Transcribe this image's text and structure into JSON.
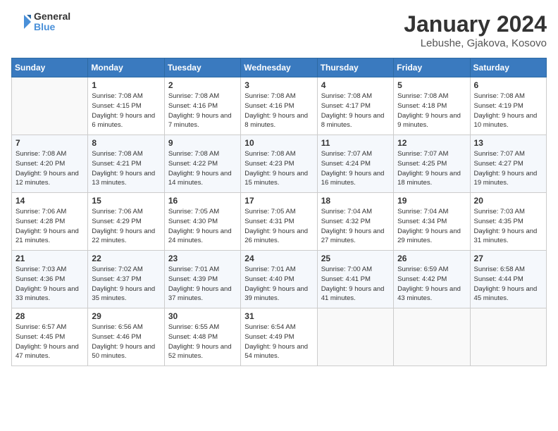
{
  "header": {
    "logo_text_general": "General",
    "logo_text_blue": "Blue",
    "month_title": "January 2024",
    "location": "Lebushe, Gjakova, Kosovo"
  },
  "days_of_week": [
    "Sunday",
    "Monday",
    "Tuesday",
    "Wednesday",
    "Thursday",
    "Friday",
    "Saturday"
  ],
  "weeks": [
    [
      {
        "num": "",
        "empty": true
      },
      {
        "num": "1",
        "sunrise": "Sunrise: 7:08 AM",
        "sunset": "Sunset: 4:15 PM",
        "daylight": "Daylight: 9 hours and 6 minutes."
      },
      {
        "num": "2",
        "sunrise": "Sunrise: 7:08 AM",
        "sunset": "Sunset: 4:16 PM",
        "daylight": "Daylight: 9 hours and 7 minutes."
      },
      {
        "num": "3",
        "sunrise": "Sunrise: 7:08 AM",
        "sunset": "Sunset: 4:16 PM",
        "daylight": "Daylight: 9 hours and 8 minutes."
      },
      {
        "num": "4",
        "sunrise": "Sunrise: 7:08 AM",
        "sunset": "Sunset: 4:17 PM",
        "daylight": "Daylight: 9 hours and 8 minutes."
      },
      {
        "num": "5",
        "sunrise": "Sunrise: 7:08 AM",
        "sunset": "Sunset: 4:18 PM",
        "daylight": "Daylight: 9 hours and 9 minutes."
      },
      {
        "num": "6",
        "sunrise": "Sunrise: 7:08 AM",
        "sunset": "Sunset: 4:19 PM",
        "daylight": "Daylight: 9 hours and 10 minutes."
      }
    ],
    [
      {
        "num": "7",
        "sunrise": "Sunrise: 7:08 AM",
        "sunset": "Sunset: 4:20 PM",
        "daylight": "Daylight: 9 hours and 12 minutes."
      },
      {
        "num": "8",
        "sunrise": "Sunrise: 7:08 AM",
        "sunset": "Sunset: 4:21 PM",
        "daylight": "Daylight: 9 hours and 13 minutes."
      },
      {
        "num": "9",
        "sunrise": "Sunrise: 7:08 AM",
        "sunset": "Sunset: 4:22 PM",
        "daylight": "Daylight: 9 hours and 14 minutes."
      },
      {
        "num": "10",
        "sunrise": "Sunrise: 7:08 AM",
        "sunset": "Sunset: 4:23 PM",
        "daylight": "Daylight: 9 hours and 15 minutes."
      },
      {
        "num": "11",
        "sunrise": "Sunrise: 7:07 AM",
        "sunset": "Sunset: 4:24 PM",
        "daylight": "Daylight: 9 hours and 16 minutes."
      },
      {
        "num": "12",
        "sunrise": "Sunrise: 7:07 AM",
        "sunset": "Sunset: 4:25 PM",
        "daylight": "Daylight: 9 hours and 18 minutes."
      },
      {
        "num": "13",
        "sunrise": "Sunrise: 7:07 AM",
        "sunset": "Sunset: 4:27 PM",
        "daylight": "Daylight: 9 hours and 19 minutes."
      }
    ],
    [
      {
        "num": "14",
        "sunrise": "Sunrise: 7:06 AM",
        "sunset": "Sunset: 4:28 PM",
        "daylight": "Daylight: 9 hours and 21 minutes."
      },
      {
        "num": "15",
        "sunrise": "Sunrise: 7:06 AM",
        "sunset": "Sunset: 4:29 PM",
        "daylight": "Daylight: 9 hours and 22 minutes."
      },
      {
        "num": "16",
        "sunrise": "Sunrise: 7:05 AM",
        "sunset": "Sunset: 4:30 PM",
        "daylight": "Daylight: 9 hours and 24 minutes."
      },
      {
        "num": "17",
        "sunrise": "Sunrise: 7:05 AM",
        "sunset": "Sunset: 4:31 PM",
        "daylight": "Daylight: 9 hours and 26 minutes."
      },
      {
        "num": "18",
        "sunrise": "Sunrise: 7:04 AM",
        "sunset": "Sunset: 4:32 PM",
        "daylight": "Daylight: 9 hours and 27 minutes."
      },
      {
        "num": "19",
        "sunrise": "Sunrise: 7:04 AM",
        "sunset": "Sunset: 4:34 PM",
        "daylight": "Daylight: 9 hours and 29 minutes."
      },
      {
        "num": "20",
        "sunrise": "Sunrise: 7:03 AM",
        "sunset": "Sunset: 4:35 PM",
        "daylight": "Daylight: 9 hours and 31 minutes."
      }
    ],
    [
      {
        "num": "21",
        "sunrise": "Sunrise: 7:03 AM",
        "sunset": "Sunset: 4:36 PM",
        "daylight": "Daylight: 9 hours and 33 minutes."
      },
      {
        "num": "22",
        "sunrise": "Sunrise: 7:02 AM",
        "sunset": "Sunset: 4:37 PM",
        "daylight": "Daylight: 9 hours and 35 minutes."
      },
      {
        "num": "23",
        "sunrise": "Sunrise: 7:01 AM",
        "sunset": "Sunset: 4:39 PM",
        "daylight": "Daylight: 9 hours and 37 minutes."
      },
      {
        "num": "24",
        "sunrise": "Sunrise: 7:01 AM",
        "sunset": "Sunset: 4:40 PM",
        "daylight": "Daylight: 9 hours and 39 minutes."
      },
      {
        "num": "25",
        "sunrise": "Sunrise: 7:00 AM",
        "sunset": "Sunset: 4:41 PM",
        "daylight": "Daylight: 9 hours and 41 minutes."
      },
      {
        "num": "26",
        "sunrise": "Sunrise: 6:59 AM",
        "sunset": "Sunset: 4:42 PM",
        "daylight": "Daylight: 9 hours and 43 minutes."
      },
      {
        "num": "27",
        "sunrise": "Sunrise: 6:58 AM",
        "sunset": "Sunset: 4:44 PM",
        "daylight": "Daylight: 9 hours and 45 minutes."
      }
    ],
    [
      {
        "num": "28",
        "sunrise": "Sunrise: 6:57 AM",
        "sunset": "Sunset: 4:45 PM",
        "daylight": "Daylight: 9 hours and 47 minutes."
      },
      {
        "num": "29",
        "sunrise": "Sunrise: 6:56 AM",
        "sunset": "Sunset: 4:46 PM",
        "daylight": "Daylight: 9 hours and 50 minutes."
      },
      {
        "num": "30",
        "sunrise": "Sunrise: 6:55 AM",
        "sunset": "Sunset: 4:48 PM",
        "daylight": "Daylight: 9 hours and 52 minutes."
      },
      {
        "num": "31",
        "sunrise": "Sunrise: 6:54 AM",
        "sunset": "Sunset: 4:49 PM",
        "daylight": "Daylight: 9 hours and 54 minutes."
      },
      {
        "num": "",
        "empty": true
      },
      {
        "num": "",
        "empty": true
      },
      {
        "num": "",
        "empty": true
      }
    ]
  ]
}
